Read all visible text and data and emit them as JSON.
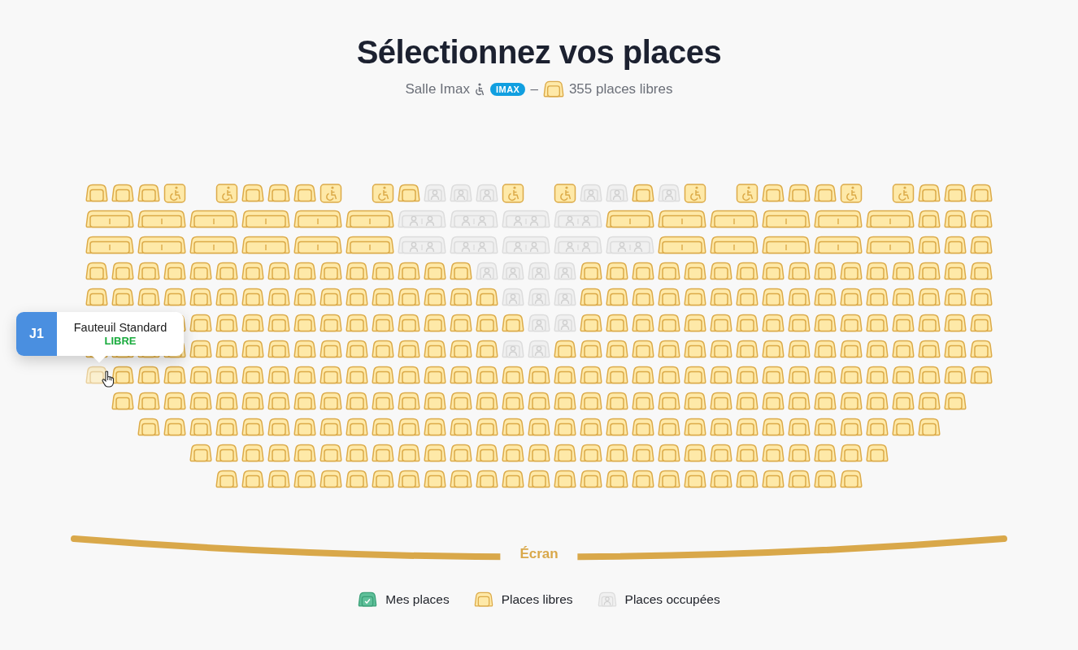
{
  "title": "Sélectionnez vos places",
  "subtitle": {
    "hall": "Salle Imax",
    "format_badge": "IMAX",
    "separator": "–",
    "free_seats": "355 places libres"
  },
  "rows": [
    {
      "seats": [
        {
          "kind": "seat",
          "occupied": false,
          "hovered": false
        },
        {
          "kind": "seat",
          "occupied": false,
          "hovered": false
        },
        {
          "kind": "seat",
          "occupied": false,
          "hovered": false
        },
        {
          "kind": "wheelchair",
          "occupied": false,
          "hovered": false
        },
        {
          "kind": "gap"
        },
        {
          "kind": "wheelchair",
          "occupied": false,
          "hovered": false
        },
        {
          "kind": "seat",
          "occupied": false,
          "hovered": false
        },
        {
          "kind": "seat",
          "occupied": false,
          "hovered": false
        },
        {
          "kind": "seat",
          "occupied": false,
          "hovered": false
        },
        {
          "kind": "wheelchair",
          "occupied": false,
          "hovered": false
        },
        {
          "kind": "gap"
        },
        {
          "kind": "wheelchair",
          "occupied": false,
          "hovered": false
        },
        {
          "kind": "seat",
          "occupied": false,
          "hovered": false
        },
        {
          "kind": "seat",
          "occupied": true,
          "hovered": false
        },
        {
          "kind": "seat",
          "occupied": true,
          "hovered": false
        },
        {
          "kind": "seat",
          "occupied": true,
          "hovered": false
        },
        {
          "kind": "wheelchair",
          "occupied": false,
          "hovered": false
        },
        {
          "kind": "gap"
        },
        {
          "kind": "wheelchair",
          "occupied": false,
          "hovered": false
        },
        {
          "kind": "seat",
          "occupied": true,
          "hovered": false
        },
        {
          "kind": "seat",
          "occupied": true,
          "hovered": false
        },
        {
          "kind": "seat",
          "occupied": false,
          "hovered": false
        },
        {
          "kind": "seat",
          "occupied": true,
          "hovered": false
        },
        {
          "kind": "wheelchair",
          "occupied": false,
          "hovered": false
        },
        {
          "kind": "gap"
        },
        {
          "kind": "wheelchair",
          "occupied": false,
          "hovered": false
        },
        {
          "kind": "seat",
          "occupied": false,
          "hovered": false
        },
        {
          "kind": "seat",
          "occupied": false,
          "hovered": false
        },
        {
          "kind": "seat",
          "occupied": false,
          "hovered": false
        },
        {
          "kind": "wheelchair",
          "occupied": false,
          "hovered": false
        },
        {
          "kind": "gap"
        },
        {
          "kind": "wheelchair",
          "occupied": false,
          "hovered": false
        },
        {
          "kind": "seat",
          "occupied": false,
          "hovered": false
        },
        {
          "kind": "seat",
          "occupied": false,
          "hovered": false
        },
        {
          "kind": "seat",
          "occupied": false,
          "hovered": false
        }
      ]
    },
    {
      "seats": [
        {
          "kind": "double",
          "occupied": false,
          "hovered": false
        },
        {
          "kind": "double",
          "occupied": false,
          "hovered": false
        },
        {
          "kind": "double",
          "occupied": false,
          "hovered": false
        },
        {
          "kind": "double",
          "occupied": false,
          "hovered": false
        },
        {
          "kind": "double",
          "occupied": false,
          "hovered": false
        },
        {
          "kind": "double",
          "occupied": false,
          "hovered": false
        },
        {
          "kind": "double",
          "occupied": true,
          "hovered": false
        },
        {
          "kind": "double",
          "occupied": true,
          "hovered": false
        },
        {
          "kind": "double",
          "occupied": true,
          "hovered": false
        },
        {
          "kind": "double",
          "occupied": true,
          "hovered": false
        },
        {
          "kind": "double",
          "occupied": false,
          "hovered": false
        },
        {
          "kind": "double",
          "occupied": false,
          "hovered": false
        },
        {
          "kind": "double",
          "occupied": false,
          "hovered": false
        },
        {
          "kind": "double",
          "occupied": false,
          "hovered": false
        },
        {
          "kind": "double",
          "occupied": false,
          "hovered": false
        },
        {
          "kind": "double",
          "occupied": false,
          "hovered": false
        },
        {
          "kind": "seat",
          "occupied": false,
          "hovered": false
        },
        {
          "kind": "seat",
          "occupied": false,
          "hovered": false
        },
        {
          "kind": "seat",
          "occupied": false,
          "hovered": false
        }
      ]
    },
    {
      "seats": [
        {
          "kind": "double",
          "occupied": false,
          "hovered": false
        },
        {
          "kind": "double",
          "occupied": false,
          "hovered": false
        },
        {
          "kind": "double",
          "occupied": false,
          "hovered": false
        },
        {
          "kind": "double",
          "occupied": false,
          "hovered": false
        },
        {
          "kind": "double",
          "occupied": false,
          "hovered": false
        },
        {
          "kind": "double",
          "occupied": false,
          "hovered": false
        },
        {
          "kind": "double",
          "occupied": true,
          "hovered": false
        },
        {
          "kind": "double",
          "occupied": true,
          "hovered": false
        },
        {
          "kind": "double",
          "occupied": true,
          "hovered": false
        },
        {
          "kind": "double",
          "occupied": true,
          "hovered": false
        },
        {
          "kind": "double",
          "occupied": true,
          "hovered": false
        },
        {
          "kind": "double",
          "occupied": false,
          "hovered": false
        },
        {
          "kind": "double",
          "occupied": false,
          "hovered": false
        },
        {
          "kind": "double",
          "occupied": false,
          "hovered": false
        },
        {
          "kind": "double",
          "occupied": false,
          "hovered": false
        },
        {
          "kind": "double",
          "occupied": false,
          "hovered": false
        },
        {
          "kind": "seat",
          "occupied": false,
          "hovered": false
        },
        {
          "kind": "seat",
          "occupied": false,
          "hovered": false
        },
        {
          "kind": "seat",
          "occupied": false,
          "hovered": false
        }
      ]
    },
    {
      "seats": [
        {
          "kind": "seat",
          "occupied": false,
          "hovered": false
        },
        {
          "kind": "seat",
          "occupied": false,
          "hovered": false
        },
        {
          "kind": "seat",
          "occupied": false,
          "hovered": false
        },
        {
          "kind": "seat",
          "occupied": false,
          "hovered": false
        },
        {
          "kind": "seat",
          "occupied": false,
          "hovered": false
        },
        {
          "kind": "seat",
          "occupied": false,
          "hovered": false
        },
        {
          "kind": "seat",
          "occupied": false,
          "hovered": false
        },
        {
          "kind": "seat",
          "occupied": false,
          "hovered": false
        },
        {
          "kind": "seat",
          "occupied": false,
          "hovered": false
        },
        {
          "kind": "seat",
          "occupied": false,
          "hovered": false
        },
        {
          "kind": "seat",
          "occupied": false,
          "hovered": false
        },
        {
          "kind": "seat",
          "occupied": false,
          "hovered": false
        },
        {
          "kind": "seat",
          "occupied": false,
          "hovered": false
        },
        {
          "kind": "seat",
          "occupied": false,
          "hovered": false
        },
        {
          "kind": "seat",
          "occupied": false,
          "hovered": false
        },
        {
          "kind": "seat",
          "occupied": true,
          "hovered": false
        },
        {
          "kind": "seat",
          "occupied": true,
          "hovered": false
        },
        {
          "kind": "seat",
          "occupied": true,
          "hovered": false
        },
        {
          "kind": "seat",
          "occupied": true,
          "hovered": false
        },
        {
          "kind": "seat",
          "occupied": false,
          "hovered": false
        },
        {
          "kind": "seat",
          "occupied": false,
          "hovered": false
        },
        {
          "kind": "seat",
          "occupied": false,
          "hovered": false
        },
        {
          "kind": "seat",
          "occupied": false,
          "hovered": false
        },
        {
          "kind": "seat",
          "occupied": false,
          "hovered": false
        },
        {
          "kind": "seat",
          "occupied": false,
          "hovered": false
        },
        {
          "kind": "seat",
          "occupied": false,
          "hovered": false
        },
        {
          "kind": "seat",
          "occupied": false,
          "hovered": false
        },
        {
          "kind": "seat",
          "occupied": false,
          "hovered": false
        },
        {
          "kind": "seat",
          "occupied": false,
          "hovered": false
        },
        {
          "kind": "seat",
          "occupied": false,
          "hovered": false
        },
        {
          "kind": "seat",
          "occupied": false,
          "hovered": false
        },
        {
          "kind": "seat",
          "occupied": false,
          "hovered": false
        },
        {
          "kind": "seat",
          "occupied": false,
          "hovered": false
        },
        {
          "kind": "seat",
          "occupied": false,
          "hovered": false
        },
        {
          "kind": "seat",
          "occupied": false,
          "hovered": false
        }
      ]
    },
    {
      "seats": [
        {
          "kind": "seat",
          "occupied": false,
          "hovered": false
        },
        {
          "kind": "seat",
          "occupied": false,
          "hovered": false
        },
        {
          "kind": "seat",
          "occupied": false,
          "hovered": false
        },
        {
          "kind": "seat",
          "occupied": false,
          "hovered": false
        },
        {
          "kind": "seat",
          "occupied": false,
          "hovered": false
        },
        {
          "kind": "seat",
          "occupied": false,
          "hovered": false
        },
        {
          "kind": "seat",
          "occupied": false,
          "hovered": false
        },
        {
          "kind": "seat",
          "occupied": false,
          "hovered": false
        },
        {
          "kind": "seat",
          "occupied": false,
          "hovered": false
        },
        {
          "kind": "seat",
          "occupied": false,
          "hovered": false
        },
        {
          "kind": "seat",
          "occupied": false,
          "hovered": false
        },
        {
          "kind": "seat",
          "occupied": false,
          "hovered": false
        },
        {
          "kind": "seat",
          "occupied": false,
          "hovered": false
        },
        {
          "kind": "seat",
          "occupied": false,
          "hovered": false
        },
        {
          "kind": "seat",
          "occupied": false,
          "hovered": false
        },
        {
          "kind": "seat",
          "occupied": false,
          "hovered": false
        },
        {
          "kind": "seat",
          "occupied": true,
          "hovered": false
        },
        {
          "kind": "seat",
          "occupied": true,
          "hovered": false
        },
        {
          "kind": "seat",
          "occupied": true,
          "hovered": false
        },
        {
          "kind": "seat",
          "occupied": false,
          "hovered": false
        },
        {
          "kind": "seat",
          "occupied": false,
          "hovered": false
        },
        {
          "kind": "seat",
          "occupied": false,
          "hovered": false
        },
        {
          "kind": "seat",
          "occupied": false,
          "hovered": false
        },
        {
          "kind": "seat",
          "occupied": false,
          "hovered": false
        },
        {
          "kind": "seat",
          "occupied": false,
          "hovered": false
        },
        {
          "kind": "seat",
          "occupied": false,
          "hovered": false
        },
        {
          "kind": "seat",
          "occupied": false,
          "hovered": false
        },
        {
          "kind": "seat",
          "occupied": false,
          "hovered": false
        },
        {
          "kind": "seat",
          "occupied": false,
          "hovered": false
        },
        {
          "kind": "seat",
          "occupied": false,
          "hovered": false
        },
        {
          "kind": "seat",
          "occupied": false,
          "hovered": false
        },
        {
          "kind": "seat",
          "occupied": false,
          "hovered": false
        },
        {
          "kind": "seat",
          "occupied": false,
          "hovered": false
        },
        {
          "kind": "seat",
          "occupied": false,
          "hovered": false
        },
        {
          "kind": "seat",
          "occupied": false,
          "hovered": false
        }
      ]
    },
    {
      "seats": [
        {
          "kind": "gap"
        },
        {
          "kind": "gap"
        },
        {
          "kind": "gap"
        },
        {
          "kind": "seat",
          "occupied": false,
          "hovered": false
        },
        {
          "kind": "seat",
          "occupied": false,
          "hovered": false
        },
        {
          "kind": "seat",
          "occupied": false,
          "hovered": false
        },
        {
          "kind": "seat",
          "occupied": false,
          "hovered": false
        },
        {
          "kind": "seat",
          "occupied": false,
          "hovered": false
        },
        {
          "kind": "seat",
          "occupied": false,
          "hovered": false
        },
        {
          "kind": "seat",
          "occupied": false,
          "hovered": false
        },
        {
          "kind": "seat",
          "occupied": false,
          "hovered": false
        },
        {
          "kind": "seat",
          "occupied": false,
          "hovered": false
        },
        {
          "kind": "seat",
          "occupied": false,
          "hovered": false
        },
        {
          "kind": "seat",
          "occupied": false,
          "hovered": false
        },
        {
          "kind": "seat",
          "occupied": false,
          "hovered": false
        },
        {
          "kind": "seat",
          "occupied": false,
          "hovered": false
        },
        {
          "kind": "seat",
          "occupied": false,
          "hovered": false
        },
        {
          "kind": "seat",
          "occupied": true,
          "hovered": false
        },
        {
          "kind": "seat",
          "occupied": true,
          "hovered": false
        },
        {
          "kind": "seat",
          "occupied": false,
          "hovered": false
        },
        {
          "kind": "seat",
          "occupied": false,
          "hovered": false
        },
        {
          "kind": "seat",
          "occupied": false,
          "hovered": false
        },
        {
          "kind": "seat",
          "occupied": false,
          "hovered": false
        },
        {
          "kind": "seat",
          "occupied": false,
          "hovered": false
        },
        {
          "kind": "seat",
          "occupied": false,
          "hovered": false
        },
        {
          "kind": "seat",
          "occupied": false,
          "hovered": false
        },
        {
          "kind": "seat",
          "occupied": false,
          "hovered": false
        },
        {
          "kind": "seat",
          "occupied": false,
          "hovered": false
        },
        {
          "kind": "seat",
          "occupied": false,
          "hovered": false
        },
        {
          "kind": "seat",
          "occupied": false,
          "hovered": false
        },
        {
          "kind": "seat",
          "occupied": false,
          "hovered": false
        },
        {
          "kind": "seat",
          "occupied": false,
          "hovered": false
        },
        {
          "kind": "seat",
          "occupied": false,
          "hovered": false
        },
        {
          "kind": "seat",
          "occupied": false,
          "hovered": false
        },
        {
          "kind": "seat",
          "occupied": false,
          "hovered": false
        }
      ]
    },
    {
      "seats": [
        {
          "kind": "seat",
          "occupied": false,
          "hovered": false
        },
        {
          "kind": "seat",
          "occupied": false,
          "hovered": false
        },
        {
          "kind": "seat",
          "occupied": false,
          "hovered": false
        },
        {
          "kind": "seat",
          "occupied": false,
          "hovered": false
        },
        {
          "kind": "seat",
          "occupied": false,
          "hovered": false
        },
        {
          "kind": "seat",
          "occupied": false,
          "hovered": false
        },
        {
          "kind": "seat",
          "occupied": false,
          "hovered": false
        },
        {
          "kind": "seat",
          "occupied": false,
          "hovered": false
        },
        {
          "kind": "seat",
          "occupied": false,
          "hovered": false
        },
        {
          "kind": "seat",
          "occupied": false,
          "hovered": false
        },
        {
          "kind": "seat",
          "occupied": false,
          "hovered": false
        },
        {
          "kind": "seat",
          "occupied": false,
          "hovered": false
        },
        {
          "kind": "seat",
          "occupied": false,
          "hovered": false
        },
        {
          "kind": "seat",
          "occupied": false,
          "hovered": false
        },
        {
          "kind": "seat",
          "occupied": false,
          "hovered": false
        },
        {
          "kind": "seat",
          "occupied": false,
          "hovered": false
        },
        {
          "kind": "seat",
          "occupied": true,
          "hovered": false
        },
        {
          "kind": "seat",
          "occupied": true,
          "hovered": false
        },
        {
          "kind": "seat",
          "occupied": false,
          "hovered": false
        },
        {
          "kind": "seat",
          "occupied": false,
          "hovered": false
        },
        {
          "kind": "seat",
          "occupied": false,
          "hovered": false
        },
        {
          "kind": "seat",
          "occupied": false,
          "hovered": false
        },
        {
          "kind": "seat",
          "occupied": false,
          "hovered": false
        },
        {
          "kind": "seat",
          "occupied": false,
          "hovered": false
        },
        {
          "kind": "seat",
          "occupied": false,
          "hovered": false
        },
        {
          "kind": "seat",
          "occupied": false,
          "hovered": false
        },
        {
          "kind": "seat",
          "occupied": false,
          "hovered": false
        },
        {
          "kind": "seat",
          "occupied": false,
          "hovered": false
        },
        {
          "kind": "seat",
          "occupied": false,
          "hovered": false
        },
        {
          "kind": "seat",
          "occupied": false,
          "hovered": false
        },
        {
          "kind": "seat",
          "occupied": false,
          "hovered": false
        },
        {
          "kind": "seat",
          "occupied": false,
          "hovered": false
        },
        {
          "kind": "seat",
          "occupied": false,
          "hovered": false
        },
        {
          "kind": "seat",
          "occupied": false,
          "hovered": false
        },
        {
          "kind": "seat",
          "occupied": false,
          "hovered": false
        }
      ]
    },
    {
      "seats": [
        {
          "kind": "seat",
          "occupied": false,
          "hovered": true
        },
        {
          "kind": "seat",
          "occupied": false,
          "hovered": false
        },
        {
          "kind": "seat",
          "occupied": false,
          "hovered": false
        },
        {
          "kind": "seat",
          "occupied": false,
          "hovered": false
        },
        {
          "kind": "seat",
          "occupied": false,
          "hovered": false
        },
        {
          "kind": "seat",
          "occupied": false,
          "hovered": false
        },
        {
          "kind": "seat",
          "occupied": false,
          "hovered": false
        },
        {
          "kind": "seat",
          "occupied": false,
          "hovered": false
        },
        {
          "kind": "seat",
          "occupied": false,
          "hovered": false
        },
        {
          "kind": "seat",
          "occupied": false,
          "hovered": false
        },
        {
          "kind": "seat",
          "occupied": false,
          "hovered": false
        },
        {
          "kind": "seat",
          "occupied": false,
          "hovered": false
        },
        {
          "kind": "seat",
          "occupied": false,
          "hovered": false
        },
        {
          "kind": "seat",
          "occupied": false,
          "hovered": false
        },
        {
          "kind": "seat",
          "occupied": false,
          "hovered": false
        },
        {
          "kind": "seat",
          "occupied": false,
          "hovered": false
        },
        {
          "kind": "seat",
          "occupied": false,
          "hovered": false
        },
        {
          "kind": "seat",
          "occupied": false,
          "hovered": false
        },
        {
          "kind": "seat",
          "occupied": false,
          "hovered": false
        },
        {
          "kind": "seat",
          "occupied": false,
          "hovered": false
        },
        {
          "kind": "seat",
          "occupied": false,
          "hovered": false
        },
        {
          "kind": "seat",
          "occupied": false,
          "hovered": false
        },
        {
          "kind": "seat",
          "occupied": false,
          "hovered": false
        },
        {
          "kind": "seat",
          "occupied": false,
          "hovered": false
        },
        {
          "kind": "seat",
          "occupied": false,
          "hovered": false
        },
        {
          "kind": "seat",
          "occupied": false,
          "hovered": false
        },
        {
          "kind": "seat",
          "occupied": false,
          "hovered": false
        },
        {
          "kind": "seat",
          "occupied": false,
          "hovered": false
        },
        {
          "kind": "seat",
          "occupied": false,
          "hovered": false
        },
        {
          "kind": "seat",
          "occupied": false,
          "hovered": false
        },
        {
          "kind": "seat",
          "occupied": false,
          "hovered": false
        },
        {
          "kind": "seat",
          "occupied": false,
          "hovered": false
        },
        {
          "kind": "seat",
          "occupied": false,
          "hovered": false
        },
        {
          "kind": "seat",
          "occupied": false,
          "hovered": false
        },
        {
          "kind": "seat",
          "occupied": false,
          "hovered": false
        }
      ]
    },
    {
      "seats": [
        {
          "kind": "seat",
          "occupied": false,
          "hovered": false
        },
        {
          "kind": "seat",
          "occupied": false,
          "hovered": false
        },
        {
          "kind": "seat",
          "occupied": false,
          "hovered": false
        },
        {
          "kind": "seat",
          "occupied": false,
          "hovered": false
        },
        {
          "kind": "seat",
          "occupied": false,
          "hovered": false
        },
        {
          "kind": "seat",
          "occupied": false,
          "hovered": false
        },
        {
          "kind": "seat",
          "occupied": false,
          "hovered": false
        },
        {
          "kind": "seat",
          "occupied": false,
          "hovered": false
        },
        {
          "kind": "seat",
          "occupied": false,
          "hovered": false
        },
        {
          "kind": "seat",
          "occupied": false,
          "hovered": false
        },
        {
          "kind": "seat",
          "occupied": false,
          "hovered": false
        },
        {
          "kind": "seat",
          "occupied": false,
          "hovered": false
        },
        {
          "kind": "seat",
          "occupied": false,
          "hovered": false
        },
        {
          "kind": "seat",
          "occupied": false,
          "hovered": false
        },
        {
          "kind": "seat",
          "occupied": false,
          "hovered": false
        },
        {
          "kind": "seat",
          "occupied": false,
          "hovered": false
        },
        {
          "kind": "seat",
          "occupied": false,
          "hovered": false
        },
        {
          "kind": "seat",
          "occupied": false,
          "hovered": false
        },
        {
          "kind": "seat",
          "occupied": false,
          "hovered": false
        },
        {
          "kind": "seat",
          "occupied": false,
          "hovered": false
        },
        {
          "kind": "seat",
          "occupied": false,
          "hovered": false
        },
        {
          "kind": "seat",
          "occupied": false,
          "hovered": false
        },
        {
          "kind": "seat",
          "occupied": false,
          "hovered": false
        },
        {
          "kind": "seat",
          "occupied": false,
          "hovered": false
        },
        {
          "kind": "seat",
          "occupied": false,
          "hovered": false
        },
        {
          "kind": "seat",
          "occupied": false,
          "hovered": false
        },
        {
          "kind": "seat",
          "occupied": false,
          "hovered": false
        },
        {
          "kind": "seat",
          "occupied": false,
          "hovered": false
        },
        {
          "kind": "seat",
          "occupied": false,
          "hovered": false
        },
        {
          "kind": "seat",
          "occupied": false,
          "hovered": false
        },
        {
          "kind": "seat",
          "occupied": false,
          "hovered": false
        },
        {
          "kind": "seat",
          "occupied": false,
          "hovered": false
        },
        {
          "kind": "seat",
          "occupied": false,
          "hovered": false
        }
      ]
    },
    {
      "seats": [
        {
          "kind": "seat",
          "occupied": false,
          "hovered": false
        },
        {
          "kind": "seat",
          "occupied": false,
          "hovered": false
        },
        {
          "kind": "seat",
          "occupied": false,
          "hovered": false
        },
        {
          "kind": "seat",
          "occupied": false,
          "hovered": false
        },
        {
          "kind": "seat",
          "occupied": false,
          "hovered": false
        },
        {
          "kind": "seat",
          "occupied": false,
          "hovered": false
        },
        {
          "kind": "seat",
          "occupied": false,
          "hovered": false
        },
        {
          "kind": "seat",
          "occupied": false,
          "hovered": false
        },
        {
          "kind": "seat",
          "occupied": false,
          "hovered": false
        },
        {
          "kind": "seat",
          "occupied": false,
          "hovered": false
        },
        {
          "kind": "seat",
          "occupied": false,
          "hovered": false
        },
        {
          "kind": "seat",
          "occupied": false,
          "hovered": false
        },
        {
          "kind": "seat",
          "occupied": false,
          "hovered": false
        },
        {
          "kind": "seat",
          "occupied": false,
          "hovered": false
        },
        {
          "kind": "seat",
          "occupied": false,
          "hovered": false
        },
        {
          "kind": "seat",
          "occupied": false,
          "hovered": false
        },
        {
          "kind": "seat",
          "occupied": false,
          "hovered": false
        },
        {
          "kind": "seat",
          "occupied": false,
          "hovered": false
        },
        {
          "kind": "seat",
          "occupied": false,
          "hovered": false
        },
        {
          "kind": "seat",
          "occupied": false,
          "hovered": false
        },
        {
          "kind": "seat",
          "occupied": false,
          "hovered": false
        },
        {
          "kind": "seat",
          "occupied": false,
          "hovered": false
        },
        {
          "kind": "seat",
          "occupied": false,
          "hovered": false
        },
        {
          "kind": "seat",
          "occupied": false,
          "hovered": false
        },
        {
          "kind": "seat",
          "occupied": false,
          "hovered": false
        },
        {
          "kind": "seat",
          "occupied": false,
          "hovered": false
        },
        {
          "kind": "seat",
          "occupied": false,
          "hovered": false
        },
        {
          "kind": "seat",
          "occupied": false,
          "hovered": false
        },
        {
          "kind": "seat",
          "occupied": false,
          "hovered": false
        },
        {
          "kind": "seat",
          "occupied": false,
          "hovered": false
        },
        {
          "kind": "seat",
          "occupied": false,
          "hovered": false
        }
      ]
    },
    {
      "seats": [
        {
          "kind": "seat",
          "occupied": false,
          "hovered": false
        },
        {
          "kind": "seat",
          "occupied": false,
          "hovered": false
        },
        {
          "kind": "seat",
          "occupied": false,
          "hovered": false
        },
        {
          "kind": "seat",
          "occupied": false,
          "hovered": false
        },
        {
          "kind": "seat",
          "occupied": false,
          "hovered": false
        },
        {
          "kind": "seat",
          "occupied": false,
          "hovered": false
        },
        {
          "kind": "seat",
          "occupied": false,
          "hovered": false
        },
        {
          "kind": "seat",
          "occupied": false,
          "hovered": false
        },
        {
          "kind": "seat",
          "occupied": false,
          "hovered": false
        },
        {
          "kind": "seat",
          "occupied": false,
          "hovered": false
        },
        {
          "kind": "seat",
          "occupied": false,
          "hovered": false
        },
        {
          "kind": "seat",
          "occupied": false,
          "hovered": false
        },
        {
          "kind": "seat",
          "occupied": false,
          "hovered": false
        },
        {
          "kind": "seat",
          "occupied": false,
          "hovered": false
        },
        {
          "kind": "seat",
          "occupied": false,
          "hovered": false
        },
        {
          "kind": "seat",
          "occupied": false,
          "hovered": false
        },
        {
          "kind": "seat",
          "occupied": false,
          "hovered": false
        },
        {
          "kind": "seat",
          "occupied": false,
          "hovered": false
        },
        {
          "kind": "seat",
          "occupied": false,
          "hovered": false
        },
        {
          "kind": "seat",
          "occupied": false,
          "hovered": false
        },
        {
          "kind": "seat",
          "occupied": false,
          "hovered": false
        },
        {
          "kind": "seat",
          "occupied": false,
          "hovered": false
        },
        {
          "kind": "seat",
          "occupied": false,
          "hovered": false
        },
        {
          "kind": "seat",
          "occupied": false,
          "hovered": false
        },
        {
          "kind": "seat",
          "occupied": false,
          "hovered": false
        },
        {
          "kind": "seat",
          "occupied": false,
          "hovered": false
        },
        {
          "kind": "seat",
          "occupied": false,
          "hovered": false
        }
      ]
    },
    {
      "seats": [
        {
          "kind": "seat",
          "occupied": false,
          "hovered": false
        },
        {
          "kind": "seat",
          "occupied": false,
          "hovered": false
        },
        {
          "kind": "seat",
          "occupied": false,
          "hovered": false
        },
        {
          "kind": "seat",
          "occupied": false,
          "hovered": false
        },
        {
          "kind": "seat",
          "occupied": false,
          "hovered": false
        },
        {
          "kind": "seat",
          "occupied": false,
          "hovered": false
        },
        {
          "kind": "seat",
          "occupied": false,
          "hovered": false
        },
        {
          "kind": "seat",
          "occupied": false,
          "hovered": false
        },
        {
          "kind": "seat",
          "occupied": false,
          "hovered": false
        },
        {
          "kind": "seat",
          "occupied": false,
          "hovered": false
        },
        {
          "kind": "seat",
          "occupied": false,
          "hovered": false
        },
        {
          "kind": "seat",
          "occupied": false,
          "hovered": false
        },
        {
          "kind": "seat",
          "occupied": false,
          "hovered": false
        },
        {
          "kind": "seat",
          "occupied": false,
          "hovered": false
        },
        {
          "kind": "seat",
          "occupied": false,
          "hovered": false
        },
        {
          "kind": "seat",
          "occupied": false,
          "hovered": false
        },
        {
          "kind": "seat",
          "occupied": false,
          "hovered": false
        },
        {
          "kind": "seat",
          "occupied": false,
          "hovered": false
        },
        {
          "kind": "seat",
          "occupied": false,
          "hovered": false
        },
        {
          "kind": "seat",
          "occupied": false,
          "hovered": false
        },
        {
          "kind": "seat",
          "occupied": false,
          "hovered": false
        },
        {
          "kind": "seat",
          "occupied": false,
          "hovered": false
        },
        {
          "kind": "seat",
          "occupied": false,
          "hovered": false
        },
        {
          "kind": "seat",
          "occupied": false,
          "hovered": false
        },
        {
          "kind": "seat",
          "occupied": false,
          "hovered": false
        }
      ]
    }
  ],
  "tooltip": {
    "seat": "J1",
    "seat_type": "Fauteuil Standard",
    "status": "LIBRE"
  },
  "screen": {
    "label": "Écran"
  },
  "legend": [
    {
      "kind": "mine",
      "label": "Mes places"
    },
    {
      "kind": "free",
      "label": "Places libres"
    },
    {
      "kind": "occupied",
      "label": "Places occupées"
    }
  ]
}
